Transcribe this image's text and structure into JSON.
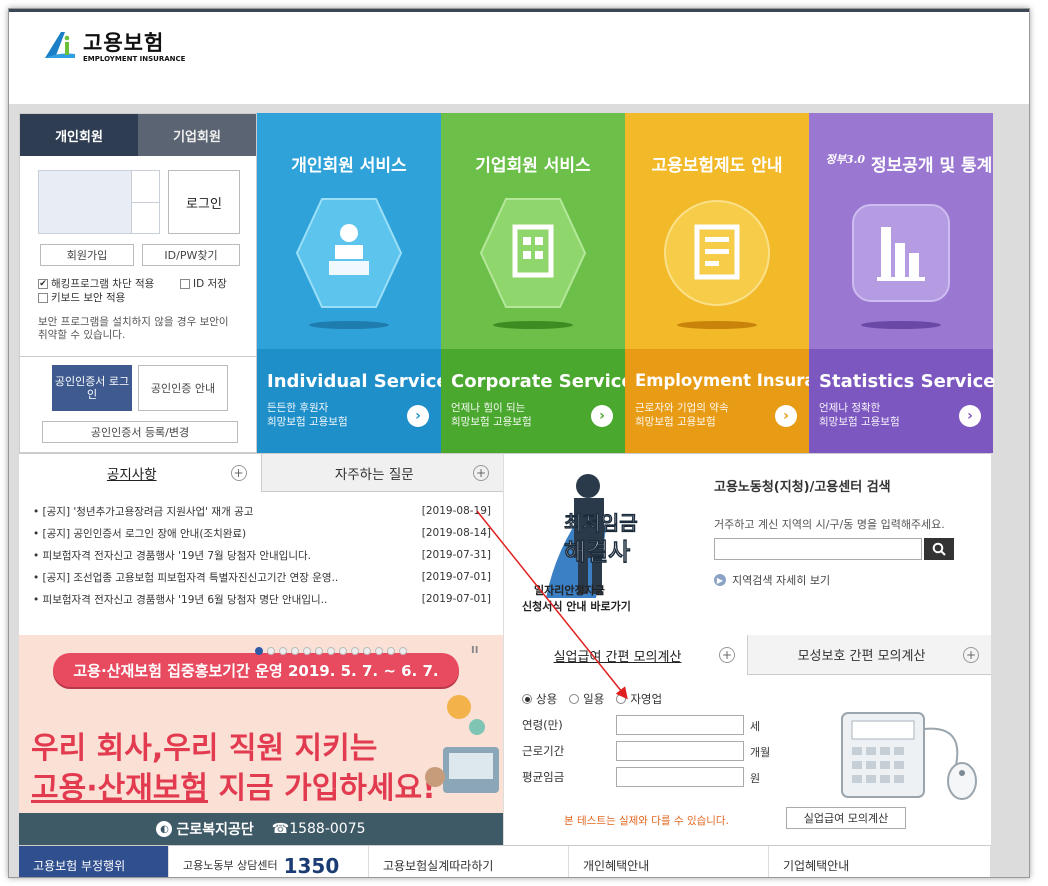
{
  "header": {
    "logo_title": "고용보험",
    "logo_sub": "EMPLOYMENT INSURANCE"
  },
  "login": {
    "tabs": [
      "개인회원",
      "기업회원"
    ],
    "login_button": "로그인",
    "signup_button": "회원가입",
    "find_button": "ID/PW찾기",
    "checks": [
      {
        "label": "해킹프로그램 차단 적용",
        "checked": true
      },
      {
        "label": "ID 저장",
        "checked": false
      },
      {
        "label": "키보드 보안 적용",
        "checked": false
      }
    ],
    "security_note": "보안 프로그램을 설치하지 않을 경우 보안이 취약할 수 있습니다.",
    "cert_login": "공인인증서 로그인",
    "cert_guide": "공인인증 안내",
    "cert_register": "공인인증서 등록/변경"
  },
  "tiles": [
    {
      "title": "개인회원 서비스",
      "en": "Individual Service",
      "ko1": "든든한 후원자",
      "ko2": "희망보험 고용보험",
      "color": "#2fa3d9",
      "dark": "#1d86bd",
      "icon": "person-icon"
    },
    {
      "title": "기업회원 서비스",
      "en": "Corporate Service",
      "ko1": "언제나 힘이 되는",
      "ko2": "희망보험 고용보험",
      "color": "#6cc04a",
      "dark": "#4ea532",
      "icon": "building-icon"
    },
    {
      "title": "고용보험제도 안내",
      "en": "Employment Insurance",
      "ko1": "근로자와 기업의 약속",
      "ko2": "희망보험 고용보험",
      "color": "#f2b928",
      "dark": "#e49a12",
      "icon": "document-icon"
    },
    {
      "title": "정보공개 및 통계",
      "badge": "정부3.0",
      "en": "Statistics Service",
      "ko1": "언제나 정확한",
      "ko2": "희망보험 고용보험",
      "color": "#9a77d1",
      "dark": "#7d58bd",
      "icon": "bar-chart-icon"
    }
  ],
  "notice": {
    "tabs": [
      "공지사항",
      "자주하는 질문"
    ],
    "items": [
      {
        "text": "[공지] '청년추가고용장려금 지원사업' 재개 공고",
        "date": "[2019-08-19]"
      },
      {
        "text": "[공지] 공인인증서 로그인 장애 안내(조치완료)",
        "date": "[2019-08-14]"
      },
      {
        "text": "피보험자격 전자신고 경품행사 '19년 7월 당첨자 안내입니다.",
        "date": "[2019-07-31]"
      },
      {
        "text": "[공지] 조선업종 고용보험 피보험자격 특별자진신고기간 연장 운영..",
        "date": "[2019-07-01]"
      },
      {
        "text": "피보험자격 전자신고 경품행사 '19년 6월 당첨자 명단 안내입니..",
        "date": "[2019-07-01]"
      }
    ]
  },
  "wage": {
    "fig_text1": "최저임금",
    "fig_text2": "해결사",
    "caption1": "일자리안정자금",
    "caption2": "신청서식 안내 바로가기",
    "search_title": "고용노동청(지청)/고용센터 검색",
    "search_desc": "거주하고 계신 지역의 시/구/동 명을 입력해주세요.",
    "search_more": "지역검색 자세히 보기"
  },
  "promo": {
    "pill": "고용·산재보험 집중홍보기간 운영  2019. 5. 7. ~ 6. 7.",
    "line1": "우리 회사,우리 직원 지키는",
    "line2a": "고용·산재보험",
    "line2b": " 지금 가입하세요!",
    "org": "근로복지공단",
    "phone": "☎1588-0075",
    "pause": "II"
  },
  "calc": {
    "tabs": [
      "실업급여 간편 모의계산",
      "모성보호 간편 모의계산"
    ],
    "radios": [
      {
        "label": "상용",
        "on": true
      },
      {
        "label": "일용",
        "on": false
      },
      {
        "label": "자영업",
        "on": false
      }
    ],
    "fields": [
      {
        "label": "연령(만)",
        "unit": "세"
      },
      {
        "label": "근로기간",
        "unit": "개월"
      },
      {
        "label": "평균임금",
        "unit": "원"
      }
    ],
    "note": "본 테스트는 실제와 다를 수 있습니다.",
    "button": "실업급여 모의계산"
  },
  "bottom": {
    "cells": [
      "고용보험 부정행위",
      "고용노동부 상담센터",
      "1350",
      "고용보험실계따라하기",
      "개인혜택안내",
      "기업혜택안내"
    ]
  }
}
